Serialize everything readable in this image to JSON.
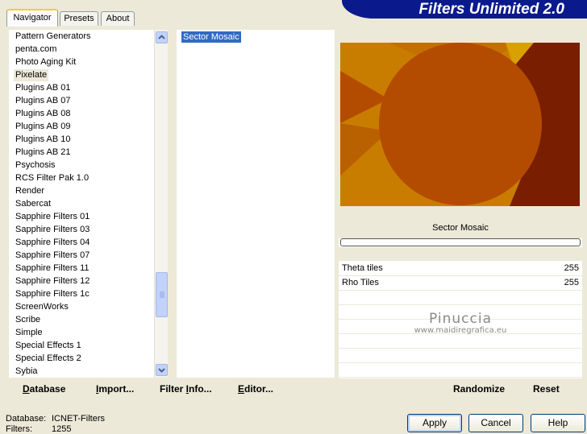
{
  "tabs": [
    "Navigator",
    "Presets",
    "About"
  ],
  "logo_text": "Filters Unlimited 2.0",
  "categories": [
    "Pattern Generators",
    "penta.com",
    "Photo Aging Kit",
    "Pixelate",
    "Plugins AB 01",
    "Plugins AB 07",
    "Plugins AB 08",
    "Plugins AB 09",
    "Plugins AB 10",
    "Plugins AB 21",
    "Psychosis",
    "RCS Filter Pak 1.0",
    "Render",
    "Sabercat",
    "Sapphire Filters 01",
    "Sapphire Filters 03",
    "Sapphire Filters 04",
    "Sapphire Filters 07",
    "Sapphire Filters 11",
    "Sapphire Filters 12",
    "Sapphire Filters 1c",
    "ScreenWorks",
    "Scribe",
    "Simple",
    "Special Effects 1",
    "Special Effects 2",
    "Sybia"
  ],
  "selected_category": "Pixelate",
  "filters": [
    "Sector Mosaic"
  ],
  "selected_filter_name": "Sector Mosaic",
  "params": [
    {
      "label": "Theta tiles",
      "value": "255"
    },
    {
      "label": "Rho Tiles",
      "value": "255"
    }
  ],
  "watermark": {
    "line1": "Pinuccia",
    "line2": "www.maidiregrafica.eu"
  },
  "bar_buttons": [
    {
      "label": "Database",
      "ul": "D"
    },
    {
      "label": "Import...",
      "ul": "I"
    },
    {
      "label": "Filter Info...",
      "ul": "I"
    },
    {
      "label": "Editor...",
      "ul": "E"
    }
  ],
  "right_buttons": {
    "randomize": "Randomize",
    "reset": "Reset"
  },
  "status": {
    "database_label": "Database:",
    "database_value": "ICNET-Filters",
    "filters_label": "Filters:",
    "filters_value": "1255"
  },
  "dialog_buttons": {
    "apply": "Apply",
    "cancel": "Cancel",
    "help": "Help"
  },
  "colors": {
    "selection": "#316ac5",
    "preview_dark": "#7a1e00",
    "preview_mid": "#b34c00",
    "preview_light": "#d28a00"
  }
}
